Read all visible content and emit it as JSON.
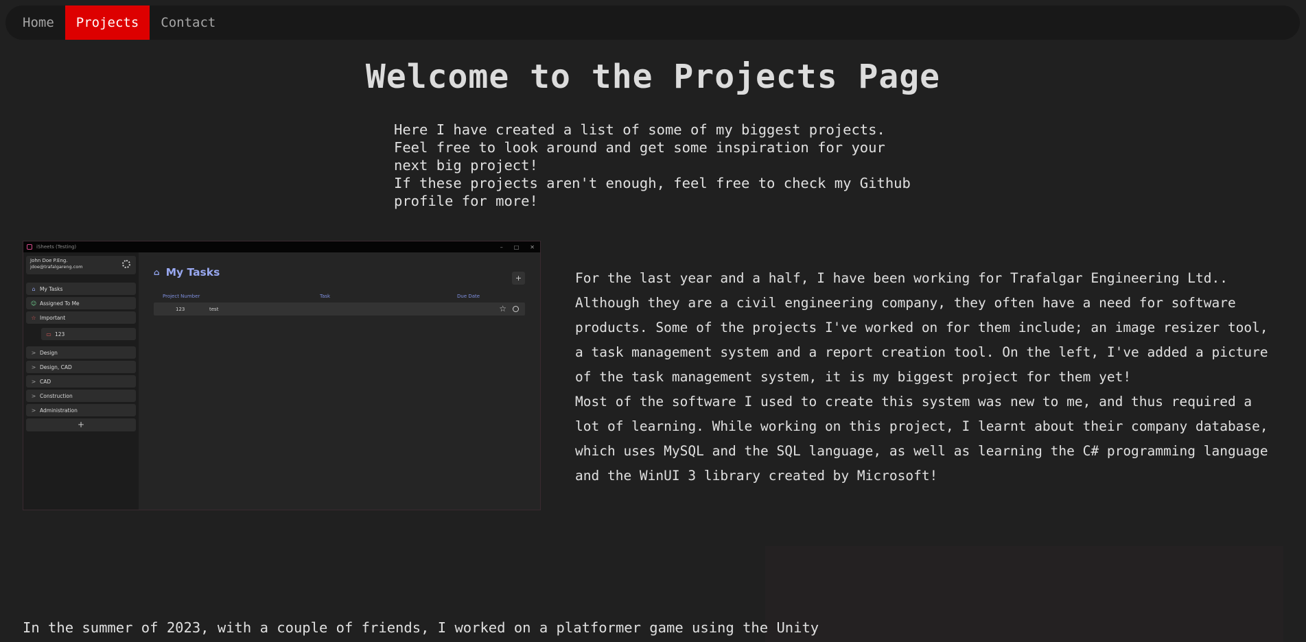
{
  "nav": {
    "items": [
      {
        "label": "Home"
      },
      {
        "label": "Projects"
      },
      {
        "label": "Contact"
      }
    ],
    "active_color": "#dd0000"
  },
  "header": {
    "title": "Welcome to the Projects Page",
    "intro": [
      "Here I have created a list of some of my biggest projects.",
      "Feel free to look around and get some inspiration for your next big project!",
      "If these projects aren't enough, feel free to check my Github profile for more!"
    ]
  },
  "task_app": {
    "window_title": "iSheets (Testing)",
    "profile": {
      "name": "John Doe P.Eng.",
      "email": "jdoe@trafalgareng.com"
    },
    "sidebar": [
      {
        "label": "My Tasks",
        "icon": "home-icon"
      },
      {
        "label": "Assigned To Me",
        "icon": "person-icon"
      },
      {
        "label": "Important",
        "icon": "star-icon"
      }
    ],
    "subitem": {
      "label": "123",
      "icon": "list-icon"
    },
    "groups": [
      {
        "label": "Design"
      },
      {
        "label": "Design, CAD"
      },
      {
        "label": "CAD"
      },
      {
        "label": "Construction"
      },
      {
        "label": "Administration"
      }
    ],
    "add_label": "+",
    "main_title": "My Tasks",
    "columns": [
      "Project Number",
      "Task",
      "Due Date"
    ],
    "rows": [
      {
        "number": "123",
        "task": "test"
      }
    ]
  },
  "description": [
    "For the last year and a half, I have been working for Trafalgar Engineering Ltd.. Although they are a civil engineering company, they often have a need for software products. Some of the projects I've worked on for them include; an image resizer tool, a task management system and a report creation tool. On the left, I've added a picture of the task management system, it is my biggest project for them yet!",
    "Most of the software I used to create this system was new to me, and thus required a lot of learning. While working on this project, I learnt about their company database, which uses MySQL and the SQL language, as well as learning the C# programming language and the WinUI 3 library created by Microsoft!"
  ],
  "game_section": {
    "text": "In the summer of 2023, with a couple of friends, I worked on a platformer game using the Unity"
  }
}
